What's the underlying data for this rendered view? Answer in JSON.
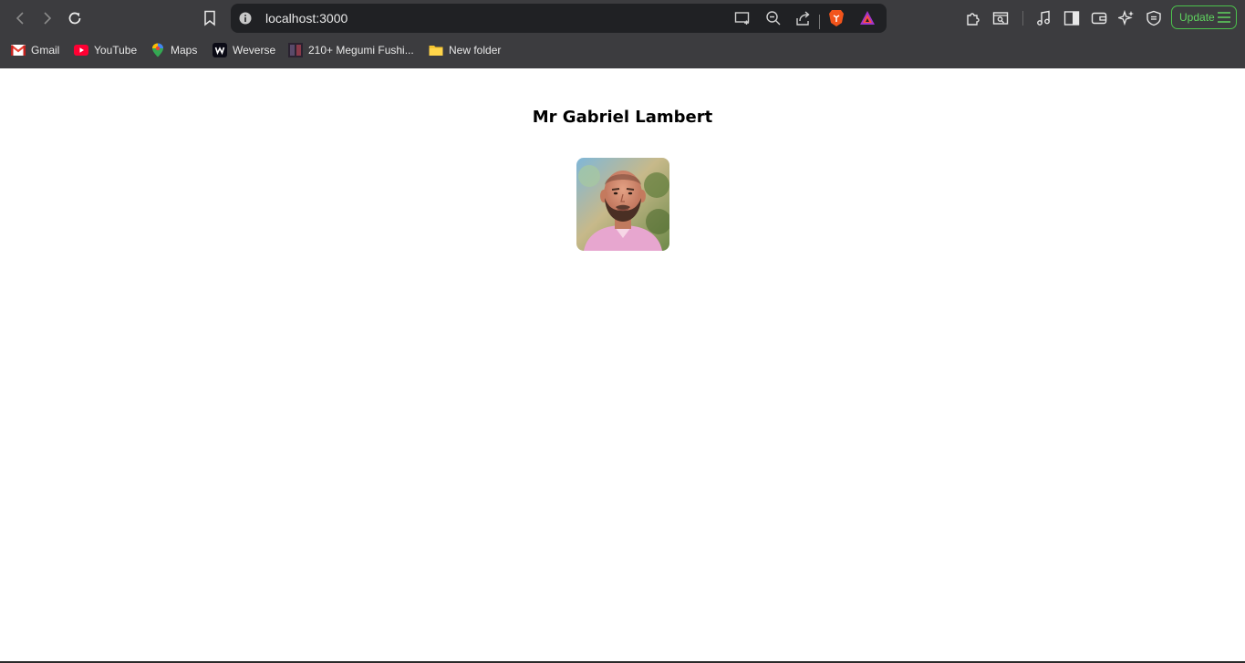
{
  "browser": {
    "url": "localhost:3000",
    "update_label": "Update",
    "accent_color": "#4cc24c",
    "bookmarks": [
      {
        "label": "Gmail",
        "icon": "gmail-icon"
      },
      {
        "label": "YouTube",
        "icon": "youtube-icon"
      },
      {
        "label": "Maps",
        "icon": "maps-icon"
      },
      {
        "label": "Weverse",
        "icon": "weverse-icon"
      },
      {
        "label": "210+ Megumi Fushi...",
        "icon": "bookmark-favicon"
      },
      {
        "label": "New folder",
        "icon": "folder-icon"
      }
    ]
  },
  "profile": {
    "name": "Mr Gabriel Lambert",
    "avatar_alt": "profile-photo"
  }
}
